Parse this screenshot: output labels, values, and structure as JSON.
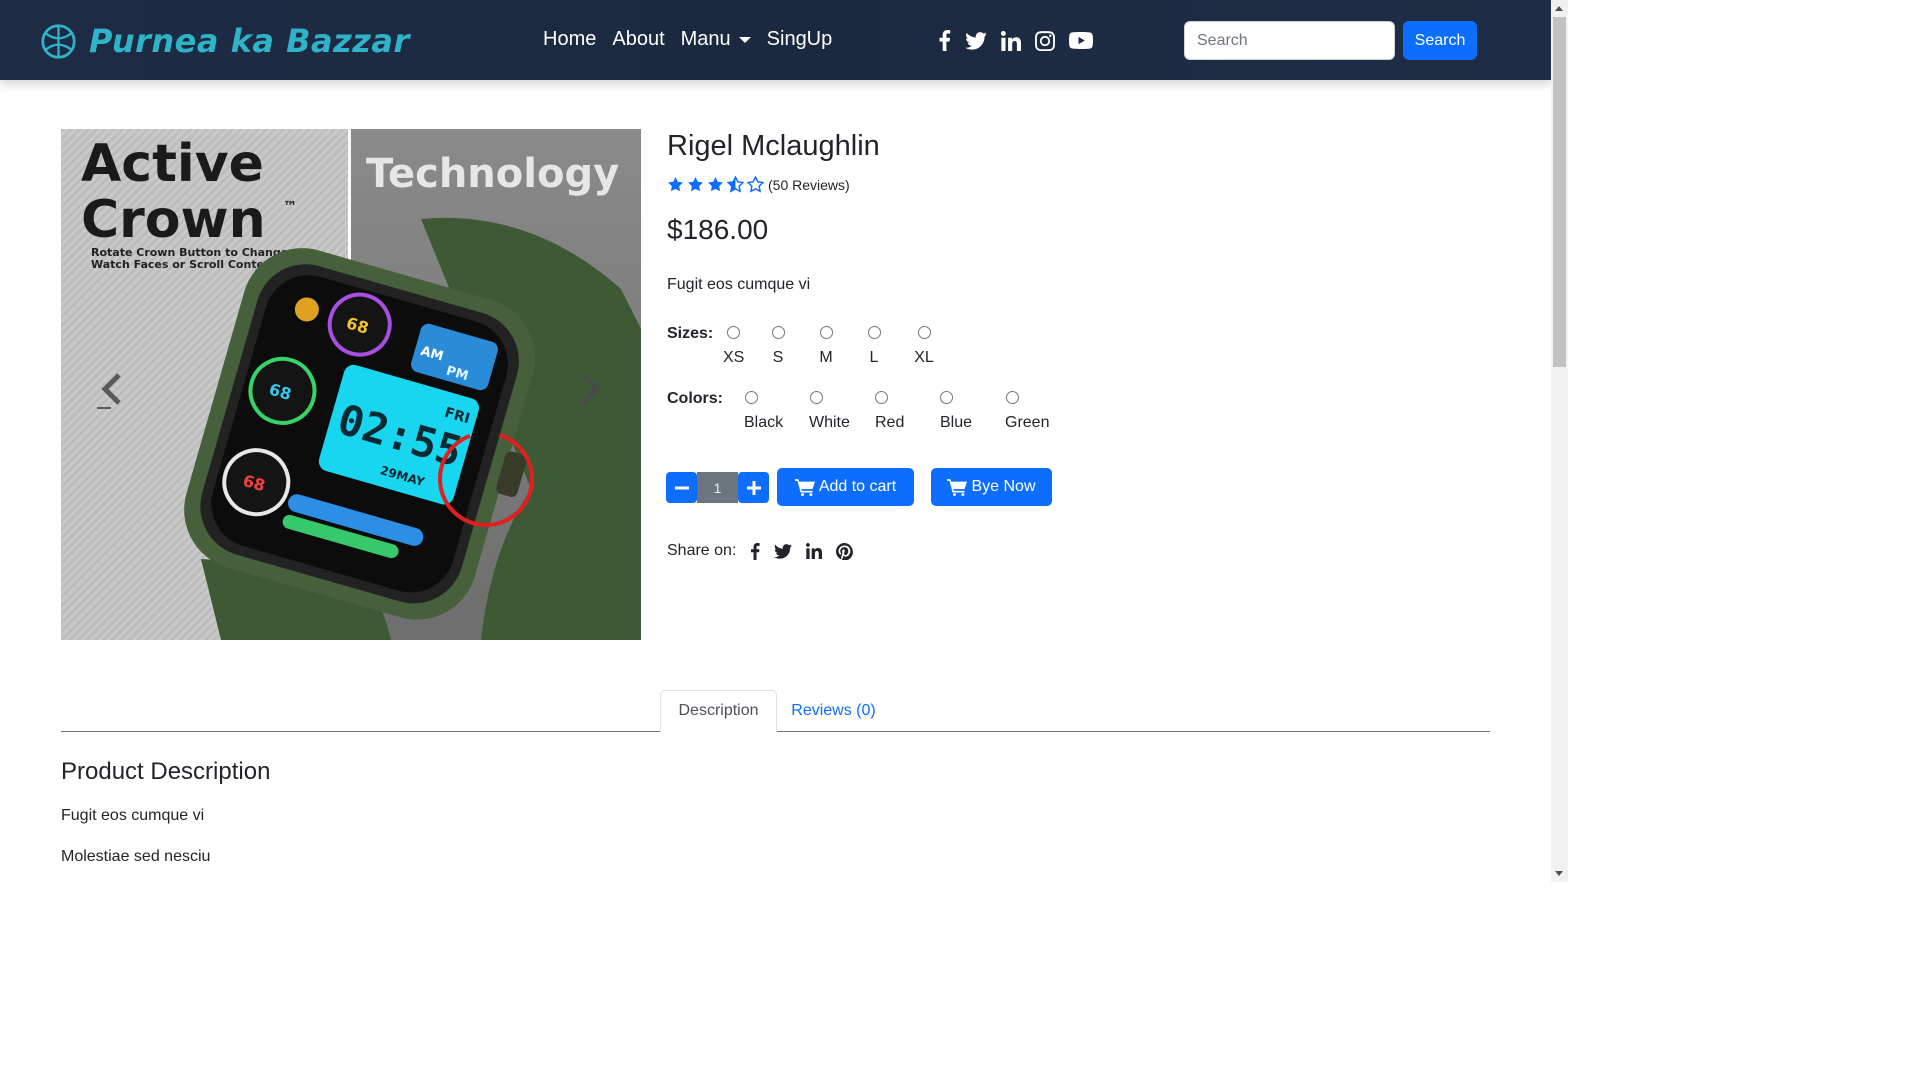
{
  "navbar": {
    "brand": "Purnea ka Bazzar",
    "links": [
      {
        "label": "Home"
      },
      {
        "label": "About"
      },
      {
        "label": "Manu"
      },
      {
        "label": "SingUp"
      }
    ],
    "social_icons": [
      "facebook-icon",
      "twitter-icon",
      "linkedin-icon",
      "instagram-icon",
      "youtube-icon"
    ],
    "search": {
      "placeholder": "Search",
      "value": "",
      "button_label": "Search"
    }
  },
  "product": {
    "image": {
      "left_text_line1": "Active",
      "left_text_line2": "Crown",
      "trademark": "™",
      "left_subtext_line1": "Rotate Crown Button to Change",
      "left_subtext_line2": "Watch Faces or Scroll Content",
      "right_text": "Technology",
      "watch_time": "02:55",
      "watch_day": "FRI",
      "watch_date": "29MAY",
      "watch_am": "AM",
      "watch_pm": "PM",
      "dial_value": "68"
    },
    "title": "Rigel Mclaughlin",
    "rating": 3.5,
    "rating_max": 5,
    "reviews_text": "(50 Reviews)",
    "price": "$186.00",
    "short_description": "Fugit eos cumque vi",
    "sizes_label": "Sizes:",
    "sizes": [
      "XS",
      "S",
      "M",
      "L",
      "XL"
    ],
    "colors_label": "Colors:",
    "colors": [
      "Black",
      "White",
      "Red",
      "Blue",
      "Green"
    ],
    "quantity": "1",
    "add_to_cart_label": "Add to cart",
    "buy_now_label": "Bye Now",
    "share_label": "Share on:",
    "share_icons": [
      "facebook-icon",
      "twitter-icon",
      "linkedin-icon",
      "pinterest-icon"
    ]
  },
  "tabs": [
    {
      "label": "Description",
      "active": true
    },
    {
      "label": "Reviews (0)",
      "active": false
    }
  ],
  "description": {
    "heading": "Product Description",
    "paragraphs": [
      "Fugit eos cumque vi",
      "Molestiae sed nesciu"
    ]
  },
  "colors": {
    "navbar_bg": "#1d2b44",
    "brand": "#2fb3c9",
    "primary": "#0d6efd",
    "qty_input_bg": "#6c757d"
  }
}
